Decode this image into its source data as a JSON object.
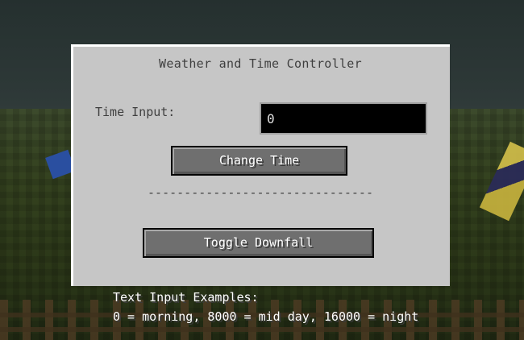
{
  "gui": {
    "title": "Weather and Time Controller",
    "time_label": "Time Input:",
    "time_value": "0",
    "change_time_label": "Change Time",
    "divider": "-------------------------------",
    "toggle_downfall_label": "Toggle Downfall"
  },
  "hints": {
    "heading": "Text Input Examples:",
    "examples": "0 = morning, 8000 = mid day, 16000 = night"
  },
  "colors": {
    "panel_background": "#c6c6c6",
    "button_face": "#6f6f6f",
    "input_background": "#000000",
    "label_text": "#3f3f3f"
  }
}
